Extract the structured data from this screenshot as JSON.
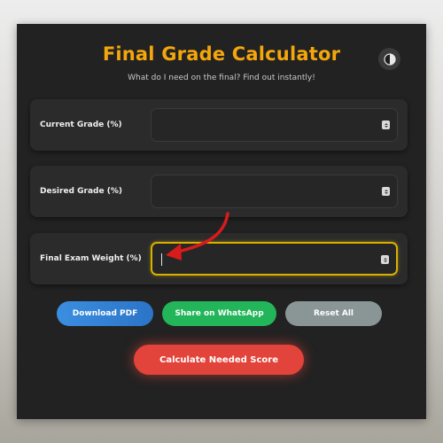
{
  "app": {
    "title": "Final Grade Calculator",
    "subtitle": "What do I need on the final? Find out instantly!"
  },
  "theme_toggle": {
    "icon": "half-moon-icon"
  },
  "fields": [
    {
      "label": "Current Grade (%)",
      "value": ""
    },
    {
      "label": "Desired Grade (%)",
      "value": ""
    },
    {
      "label": "Final Exam Weight (%)",
      "value": ""
    }
  ],
  "buttons": {
    "download_pdf": "Download PDF",
    "share_whatsapp": "Share on WhatsApp",
    "reset_all": "Reset All",
    "calculate": "Calculate Needed Score"
  },
  "colors": {
    "accent": "#f4a60d",
    "focus_border": "#d8b100",
    "pdf": "#2f80d6",
    "whatsapp": "#22b559",
    "reset": "#8a9696",
    "calculate": "#e2433a",
    "arrow": "#d81b1b"
  }
}
